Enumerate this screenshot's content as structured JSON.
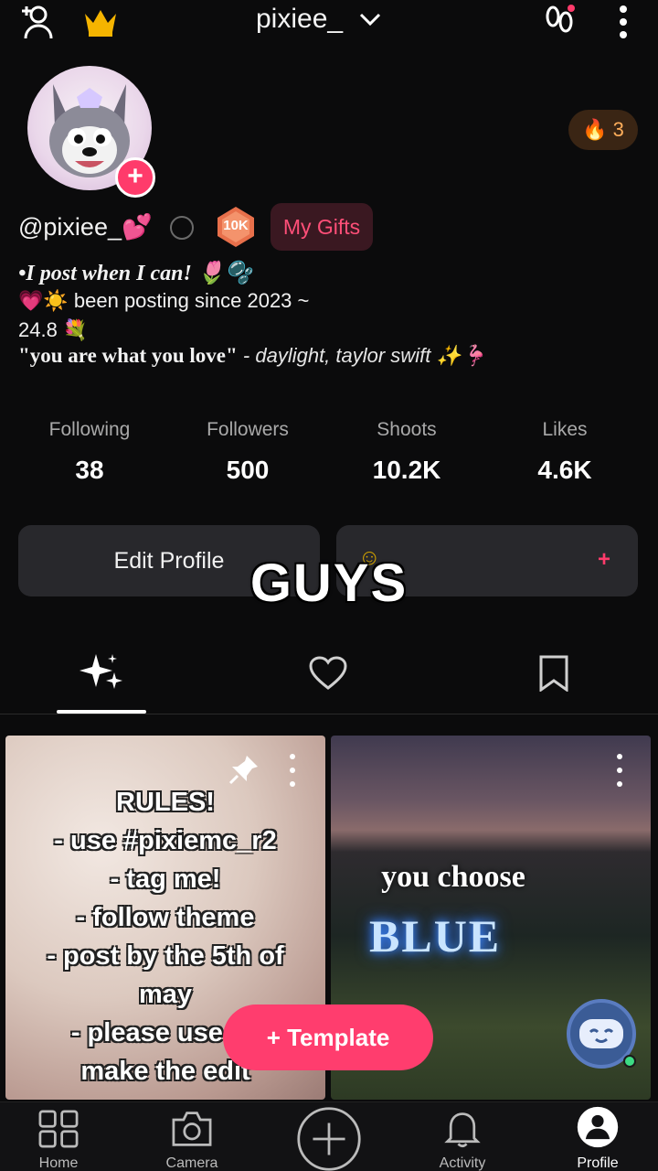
{
  "header": {
    "username": "pixiee_",
    "icons": [
      "add-friend-icon",
      "crown-icon",
      "chevron-down-icon",
      "footprints-icon",
      "more-vert-icon"
    ]
  },
  "profile": {
    "streak_count": "3",
    "handle": "@pixiee_💕",
    "level_badge": "10K",
    "gifts_label": "My Gifts",
    "bio": {
      "line1": "•I post when I can! 🌷🫧",
      "line2": "💗☀️ been posting since 2023 ~",
      "line3": "24.8 💐",
      "line4_quote": "\"you are what you love\"",
      "line4_source": " - daylight, taylor swift ✨🦩"
    }
  },
  "stats": [
    {
      "label": "Following",
      "value": "38"
    },
    {
      "label": "Followers",
      "value": "500"
    },
    {
      "label": "Shoots",
      "value": "10.2K"
    },
    {
      "label": "Likes",
      "value": "4.6K"
    }
  ],
  "actions": {
    "edit_profile": "Edit Profile",
    "second_button_plus": "+"
  },
  "overlay_caption": "GUYS",
  "tabs": [
    "sparkles-icon",
    "heart-icon",
    "bookmark-icon"
  ],
  "posts": [
    {
      "lines": [
        "RULES!",
        "- use #pixiemc_r2",
        "- tag me!",
        "- follow theme",
        "- post by the 5th of",
        "may",
        "- please use zo",
        "make the edit"
      ]
    },
    {
      "line1": "you choose",
      "line2": "BLUE"
    }
  ],
  "template_button": "+ Template",
  "bottom_nav": [
    "Home",
    "Camera",
    "",
    "Activity",
    "Profile"
  ],
  "colors": {
    "accent": "#ff3d6e",
    "background": "#0b0b0c"
  }
}
